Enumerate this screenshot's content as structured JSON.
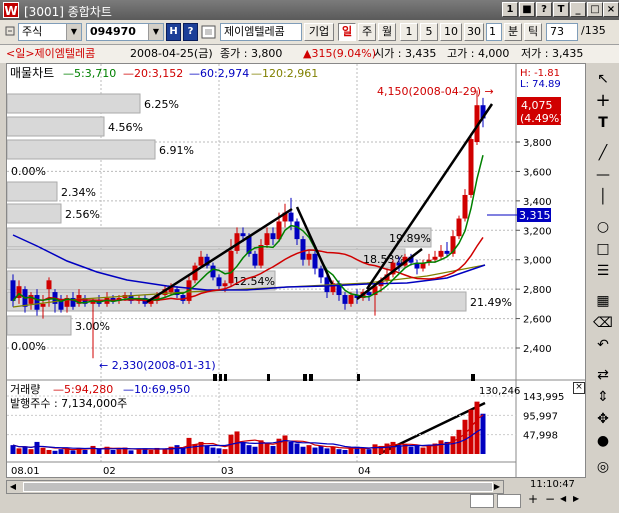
{
  "window": {
    "title": "[3001] 종합차트",
    "controls": [
      "1",
      "■",
      "?",
      "T",
      "_",
      "□",
      "×"
    ]
  },
  "toolbar": {
    "market": "주식",
    "code": "094970",
    "h_label": "H",
    "q_label": "?",
    "name": "제이엠텔레콤",
    "company_btn": "기업",
    "periods": [
      "일",
      "주",
      "월"
    ],
    "active_period": "일",
    "minutes": [
      "1",
      "5",
      "10",
      "30"
    ],
    "count_value": "1",
    "min_label": "분",
    "tick_label": "틱",
    "range_value": "73",
    "range_total": "/135"
  },
  "info": {
    "stock": "<일>제이엠텔레콤",
    "date": "2008-04-25(금)",
    "close": "종가 : 3,800",
    "change": "▲315(9.04%)",
    "open": "시가 : 3,435",
    "high": "고가 : 4,000",
    "low": "저가 : 3,435",
    "colors": {
      "stock": "#d00000",
      "up": "#d00000"
    }
  },
  "price_panel": {
    "title": "매물차트",
    "legend": [
      {
        "label": "—5:3,710",
        "color": "#008000"
      },
      {
        "label": "—20:3,152",
        "color": "#d00000"
      },
      {
        "label": "—60:2,974",
        "color": "#0000c0"
      },
      {
        "label": "—120:2,961",
        "color": "#808000"
      }
    ],
    "hl": {
      "h": "H: -1.81",
      "l": "L: 74.89"
    },
    "current_price": "4,075",
    "current_pct": "(4.49%)",
    "marker_price": "3,315",
    "annot_high": "4,150(2008-04-29) →",
    "annot_low": "← 2,330(2008-01-31)",
    "y_ticks": [
      "3,800",
      "3,600",
      "3,400",
      "3,200",
      "3,000",
      "2,800",
      "2,600",
      "2,400"
    ],
    "y_values": [
      3800,
      3600,
      3400,
      3200,
      3000,
      2800,
      2600,
      2400
    ],
    "volume_profile": [
      {
        "pct_label": "6.25%",
        "pct": 6.25
      },
      {
        "pct_label": "4.56%",
        "pct": 4.56
      },
      {
        "pct_label": "6.91%",
        "pct": 6.91
      },
      {
        "pct_label": "0.00%",
        "pct": 0
      },
      {
        "pct_label": "2.34%",
        "pct": 2.34
      },
      {
        "pct_label": "2.56%",
        "pct": 2.56
      },
      {
        "pct_label": "19.89%",
        "pct": 19.89
      },
      {
        "pct_label": "18.53%",
        "pct": 18.53
      },
      {
        "pct_label": "12.54%",
        "pct": 12.54
      },
      {
        "pct_label": "21.49%",
        "pct": 21.49
      },
      {
        "pct_label": "3.00%",
        "pct": 3.0
      },
      {
        "pct_label": "0.00%",
        "pct": 0
      }
    ]
  },
  "volume_panel": {
    "title": "거래량",
    "legend": [
      {
        "label": "—5:94,280",
        "color": "#d00000"
      },
      {
        "label": "—10:69,950",
        "color": "#0000c0"
      }
    ],
    "shares": "발행주수 : 7,134,000주",
    "max_label": "130,246",
    "y_ticks": [
      "143,995",
      "95,997",
      "47,998"
    ]
  },
  "x_labels": [
    "08.01",
    "02",
    "03",
    "04"
  ],
  "bottom": {
    "time": "11:10:47"
  },
  "chart_data": {
    "type": "candlestick",
    "series": [
      {
        "name": "5",
        "color": "#008000"
      },
      {
        "name": "20",
        "color": "#d00000"
      },
      {
        "name": "60",
        "color": "#0000c0"
      },
      {
        "name": "120",
        "color": "#808000"
      }
    ],
    "last": {
      "date": "2008-04-25",
      "open": 3435,
      "high": 4000,
      "low": 3435,
      "close": 3800
    },
    "ylim": [
      2300,
      4150
    ]
  }
}
